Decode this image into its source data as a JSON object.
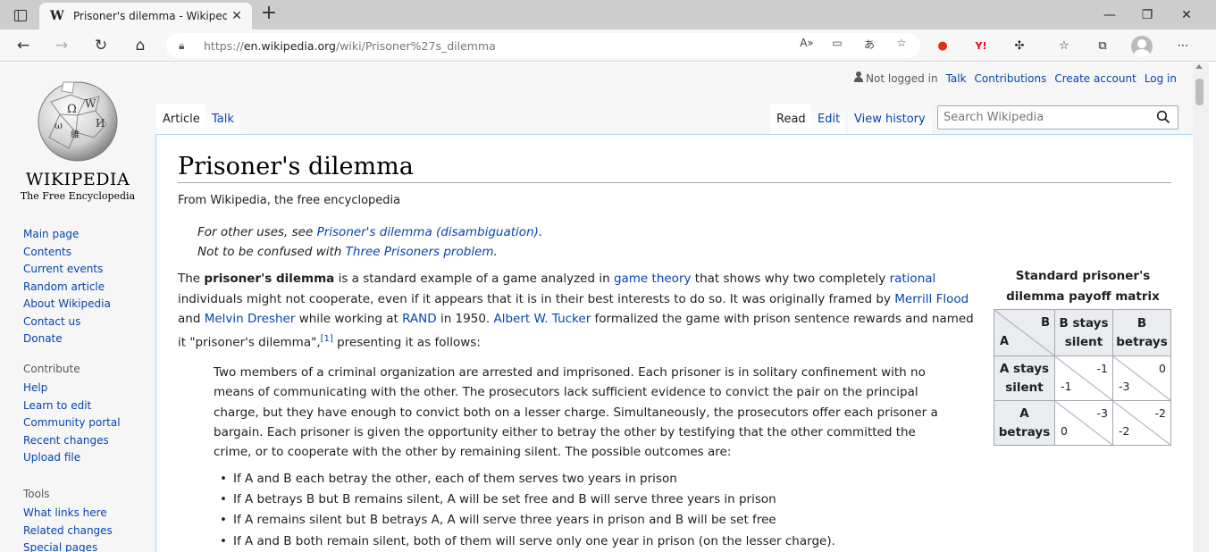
{
  "browser": {
    "tab_title": "Prisoner's dilemma - Wikipedia",
    "tab_favicon": "W",
    "url_prefix": "https://",
    "url_host": "en.wikipedia.org",
    "url_path": "/wiki/Prisoner%27s_dilemma",
    "icons": [
      "tab-actions-icon",
      "close-icon",
      "new-tab-icon",
      "minimize-icon",
      "restore-icon",
      "window-close-icon",
      "back-icon",
      "forward-icon",
      "refresh-icon",
      "home-icon",
      "lock-icon",
      "read-aloud-icon",
      "immersive-reader-icon",
      "translate-icon",
      "add-favorite-icon",
      "extension-red-icon",
      "extension-yahoo-icon",
      "extensions-icon",
      "favorites-icon",
      "collections-icon",
      "profile-icon",
      "more-icon"
    ]
  },
  "logo": {
    "wordmark": "Wikipedia",
    "tagline": "The Free Encyclopedia"
  },
  "sidebar": {
    "nav": [
      "Main page",
      "Contents",
      "Current events",
      "Random article",
      "About Wikipedia",
      "Contact us",
      "Donate"
    ],
    "contribute_heading": "Contribute",
    "contribute": [
      "Help",
      "Learn to edit",
      "Community portal",
      "Recent changes",
      "Upload file"
    ],
    "tools_heading": "Tools",
    "tools": [
      "What links here",
      "Related changes",
      "Special pages"
    ]
  },
  "personal": {
    "not_logged_in": "Not logged in",
    "talk": "Talk",
    "contributions": "Contributions",
    "create_account": "Create account",
    "log_in": "Log in"
  },
  "page_tabs": {
    "article": "Article",
    "talk": "Talk",
    "read": "Read",
    "edit": "Edit",
    "view_history": "View history"
  },
  "search": {
    "placeholder": "Search Wikipedia"
  },
  "article": {
    "title": "Prisoner's dilemma",
    "subtitle": "From Wikipedia, the free encyclopedia",
    "hatnote1_prefix": "For other uses, see ",
    "hatnote1_link": "Prisoner's dilemma (disambiguation)",
    "hatnote1_suffix": ".",
    "hatnote2_prefix": "Not to be confused with ",
    "hatnote2_link": "Three Prisoners problem",
    "hatnote2_suffix": ".",
    "intro": {
      "t1": "The ",
      "bold": "prisoner's dilemma",
      "t2": " is a standard example of a game analyzed in ",
      "l1": "game theory",
      "t3": " that shows why two completely ",
      "l2": "rational",
      "t4": " individuals might not cooperate, even if it appears that it is in their best interests to do so. It was originally framed by ",
      "l3": "Merrill Flood",
      "t5": " and ",
      "l4": "Melvin Dresher",
      "t6": " while working at ",
      "l5": "RAND",
      "t7": " in 1950. ",
      "l6": "Albert W. Tucker",
      "t8": " formalized the game with prison sentence rewards and named it \"prisoner's dilemma\",",
      "cite": "[1]",
      "t9": " presenting it as follows:"
    },
    "quote": "Two members of a criminal organization are arrested and imprisoned. Each prisoner is in solitary confinement with no means of communicating with the other. The prosecutors lack sufficient evidence to convict the pair on the principal charge, but they have enough to convict both on a lesser charge. Simultaneously, the prosecutors offer each prisoner a bargain. Each prisoner is given the opportunity either to betray the other by testifying that the other committed the crime, or to cooperate with the other by remaining silent. The possible outcomes are:",
    "outcomes": [
      "If A and B each betray the other, each of them serves two years in prison",
      "If A betrays B but B remains silent, A will be set free and B will serve three years in prison",
      "If A remains silent but B betrays A, A will serve three years in prison and B will be set free",
      "If A and B both remain silent, both of them will serve only one year in prison (on the lesser charge)."
    ]
  },
  "infobox": {
    "caption": "Standard prisoner's dilemma payoff matrix",
    "corner_b": "B",
    "corner_a": "A",
    "col1": "B stays silent",
    "col2": "B betrays",
    "row1": "A stays silent",
    "row2": "A betrays",
    "r1c1_b": "-1",
    "r1c1_a": "-1",
    "r1c2_b": "0",
    "r1c2_a": "-3",
    "r2c1_b": "-3",
    "r2c1_a": "0",
    "r2c2_b": "-2",
    "r2c2_a": "-2"
  }
}
